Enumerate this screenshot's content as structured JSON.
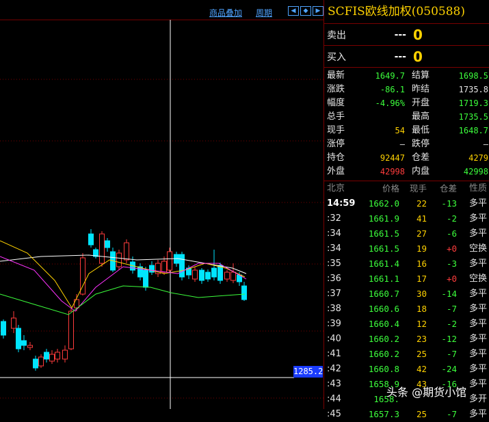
{
  "toolbar": {
    "overlay_label": "商品叠加",
    "period_label": "周期"
  },
  "colors": {
    "up": "#ff3c3c",
    "down": "#00e5ff",
    "bull_body": "#000000",
    "green": "#3cff3c",
    "yellow": "#ffd200",
    "grid": "#7a0000"
  },
  "price_tag": "1285.2",
  "panel": {
    "title": "SCFIS欧线加权(050588)",
    "sell": {
      "label": "卖出",
      "price": "---",
      "qty": "0"
    },
    "buy": {
      "label": "买入",
      "price": "---",
      "qty": "0"
    },
    "stats": [
      {
        "k": "最新",
        "v": "1649.7",
        "vc": "green",
        "k2": "结算",
        "v2": "1698.5",
        "v2c": "green"
      },
      {
        "k": "涨跌",
        "v": "-86.1",
        "vc": "green",
        "k2": "昨结",
        "v2": "1735.8",
        "v2c": "white"
      },
      {
        "k": "幅度",
        "v": "-4.96%",
        "vc": "green",
        "k2": "开盘",
        "v2": "1719.3",
        "v2c": "green"
      },
      {
        "k": "总手",
        "v": "",
        "vc": "yellow",
        "k2": "最高",
        "v2": "1735.5",
        "v2c": "green"
      },
      {
        "k": "现手",
        "v": "54",
        "vc": "yellow",
        "k2": "最低",
        "v2": "1648.7",
        "v2c": "green"
      },
      {
        "k": "涨停",
        "v": "—",
        "vc": "white",
        "k2": "跌停",
        "v2": "—",
        "v2c": "white"
      },
      {
        "k": "持仓",
        "v": "92447",
        "vc": "yellow",
        "k2": "仓差",
        "v2": "4279",
        "v2c": "yellow"
      },
      {
        "k": "外盘",
        "v": "42998",
        "vc": "red",
        "k2": "内盘",
        "v2": "42998",
        "v2c": "green"
      }
    ],
    "ticks_header": [
      "北京",
      "价格",
      "现手",
      "仓差",
      "性质"
    ],
    "ticks": [
      {
        "t": "14:59",
        "p": "1662.0",
        "q": "22",
        "d": "-13",
        "n": "多平"
      },
      {
        "t": ":32",
        "p": "1661.9",
        "q": "41",
        "d": "-2",
        "n": "多平"
      },
      {
        "t": ":34",
        "p": "1661.5",
        "q": "27",
        "d": "-6",
        "n": "多平"
      },
      {
        "t": ":34",
        "p": "1661.5",
        "q": "19",
        "d": "+0",
        "n": "空换"
      },
      {
        "t": ":35",
        "p": "1661.4",
        "q": "16",
        "d": "-3",
        "n": "多平"
      },
      {
        "t": ":36",
        "p": "1661.1",
        "q": "17",
        "d": "+0",
        "n": "空换"
      },
      {
        "t": ":37",
        "p": "1660.7",
        "q": "30",
        "d": "-14",
        "n": "多平"
      },
      {
        "t": ":38",
        "p": "1660.6",
        "q": "18",
        "d": "-7",
        "n": "多平"
      },
      {
        "t": ":39",
        "p": "1660.4",
        "q": "12",
        "d": "-2",
        "n": "多平"
      },
      {
        "t": ":40",
        "p": "1660.2",
        "q": "23",
        "d": "-12",
        "n": "多平"
      },
      {
        "t": ":41",
        "p": "1660.2",
        "q": "25",
        "d": "-7",
        "n": "多平"
      },
      {
        "t": ":42",
        "p": "1660.8",
        "q": "42",
        "d": "-24",
        "n": "多平"
      },
      {
        "t": ":43",
        "p": "1658.9",
        "q": "43",
        "d": "-16",
        "n": "多平"
      },
      {
        "t": ":44",
        "p": "1658.",
        "q": "",
        "d": "",
        "n": "多开"
      },
      {
        "t": ":45",
        "p": "1657.3",
        "q": "25",
        "d": "-7",
        "n": "多平"
      }
    ]
  },
  "watermark": "头条 @期货小馆"
}
